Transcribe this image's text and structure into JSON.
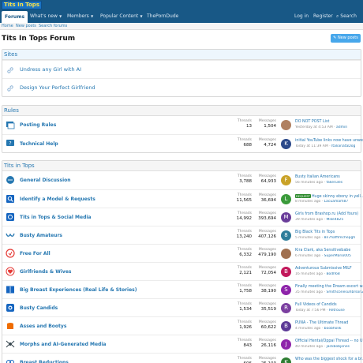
{
  "header": {
    "logo": "Tits In Tops"
  },
  "nav": {
    "forums": "Forums",
    "whats_new": "What's new",
    "members": "Members",
    "popular": "Popular Content",
    "pornduce": "ThePornDude",
    "login": "Log in",
    "register": "Register",
    "search": "Search"
  },
  "subnav": {
    "home": "Home",
    "new_posts": "New posts",
    "search_forums": "Search forums"
  },
  "page": {
    "title": "Tits In Tops Forum",
    "new_posts_btn": "New posts"
  },
  "sites": {
    "heading": "Sites",
    "links": [
      {
        "label": "Undress any Girl with AI",
        "icon": "link-icon"
      },
      {
        "label": "Design Your Perfect Girlfriend",
        "icon": "link-icon"
      }
    ]
  },
  "stat_labels": {
    "threads": "Threads",
    "messages": "Messages"
  },
  "rules": {
    "heading": "Rules",
    "forums": [
      {
        "title": "Posting Rules",
        "icon": "forum-list-icon",
        "icon_color": "#2577b1",
        "threads": "13",
        "messages": "1,504",
        "latest_title": "DO NOT POST List",
        "latest_time": "Yesterday at 4:53 AM",
        "latest_user": "admin",
        "avatar": "",
        "avatar_color": "#b08060",
        "badge": ""
      },
      {
        "title": "Technical Help",
        "icon": "help-icon",
        "icon_color": "#2577b1",
        "threads": "688",
        "messages": "4,724",
        "latest_title": "initial YouTube links now have unwe...",
        "latest_time": "Today at 11:39 AM",
        "latest_user": "ItalianataDog",
        "avatar": "K",
        "avatar_color": "#2c4a8a",
        "badge": ""
      }
    ]
  },
  "tits": {
    "heading": "Tits in Tops",
    "forums": [
      {
        "title": "General Discussion",
        "icon": "chat-icon",
        "icon_color": "#2577b1",
        "threads": "3,788",
        "messages": "64,933",
        "latest_title": "Busty Italian Americans",
        "latest_time": "56 minutes ago",
        "latest_user": "fakerules",
        "avatar": "F",
        "avatar_color": "#c9a227",
        "badge": ""
      },
      {
        "title": "Identify a Model & Requests",
        "icon": "identify-icon",
        "icon_color": "#1565c0",
        "threads": "11,565",
        "messages": "36,694",
        "latest_title": "Huge skinny ebony in yell...",
        "latest_time": "8 minutes ago",
        "latest_user": "Lacuamam87",
        "avatar": "L",
        "avatar_color": "#3a9a3a",
        "badge": "REQUEST"
      },
      {
        "title": "Tits in Tops & Social Media",
        "icon": "social-icon",
        "icon_color": "#1565c0",
        "threads": "14,992",
        "messages": "393,694",
        "latest_title": "Girls from Brashop.ru (Add Yours)",
        "latest_time": "39 minutes ago",
        "latest_user": "Mike4825",
        "avatar": "M",
        "avatar_color": "#6a3d9a",
        "badge": ""
      },
      {
        "title": "Busty Amateurs",
        "icon": "bra-icon",
        "icon_color": "#2577b1",
        "threads": "13,240",
        "messages": "407,126",
        "latest_title": "Big Black Tits in Tops",
        "latest_time": "5 minutes ago",
        "latest_user": "8n7hafflmchepgh",
        "avatar": "8",
        "avatar_color": "#2e7d9a",
        "badge": ""
      },
      {
        "title": "Free For All",
        "icon": "free-icon",
        "icon_color": "#e53935",
        "threads": "6,332",
        "messages": "479,190",
        "latest_title": "Kira Clark, aka Sensitivebabe",
        "latest_time": "6 minutes ago",
        "latest_user": "SuperMario005",
        "avatar": "",
        "avatar_color": "#a07050",
        "badge": ""
      },
      {
        "title": "Girlfriends & Wives",
        "icon": "heart-icon",
        "icon_color": "#e53935",
        "threads": "2,121",
        "messages": "72,054",
        "latest_title": "Adventurous Submissive MILF",
        "latest_time": "16 minutes ago",
        "latest_user": "Bodh68",
        "avatar": "B",
        "avatar_color": "#c2185b",
        "badge": ""
      },
      {
        "title": "Big Breast Experiences (Real Life & Stories)",
        "icon": "book-icon",
        "icon_color": "#1565c0",
        "threads": "1,758",
        "messages": "38,190",
        "latest_title": "Finally meeting the Dream escort w...",
        "latest_time": "35 minutes ago",
        "latest_user": "Smithconesuhbrson2",
        "avatar": "S",
        "avatar_color": "#8e24aa",
        "badge": ""
      },
      {
        "title": "Busty Candids",
        "icon": "camera-icon",
        "icon_color": "#1565c0",
        "threads": "1,534",
        "messages": "35,519",
        "latest_title": "Full Videos of Candids",
        "latest_time": "Today at 7:56 PM",
        "latest_user": "Retrouse",
        "avatar": "R",
        "avatar_color": "#7b3fa0",
        "badge": ""
      },
      {
        "title": "Asses and Bootys",
        "icon": "bootys-icon",
        "icon_color": "#ef6c00",
        "threads": "1,926",
        "messages": "60,622",
        "latest_title": "PUNA - The Ultimate Thread",
        "latest_time": "4 minutes ago",
        "latest_user": "boobholik",
        "avatar": "B",
        "avatar_color": "#5c3a96",
        "badge": ""
      },
      {
        "title": "Morphs and AI-Generated Media",
        "icon": "morph-icon",
        "icon_color": "#37474f",
        "threads": "843",
        "messages": "26,116",
        "latest_title": "Official Hentai/Oppai Thread -- no U...",
        "latest_time": "40 minutes ago",
        "latest_user": "jackbobjones",
        "avatar": "J",
        "avatar_color": "#8e24aa",
        "badge": ""
      },
      {
        "title": "Breast Reductions",
        "icon": "reduction-icon",
        "icon_color": "#1565c0",
        "threads": "606",
        "messages": "25,103",
        "latest_title": "Who was the biggest shock for a br...",
        "latest_time": "",
        "latest_user": "",
        "avatar": "K",
        "avatar_color": "#2e7d32",
        "badge": ""
      }
    ]
  }
}
